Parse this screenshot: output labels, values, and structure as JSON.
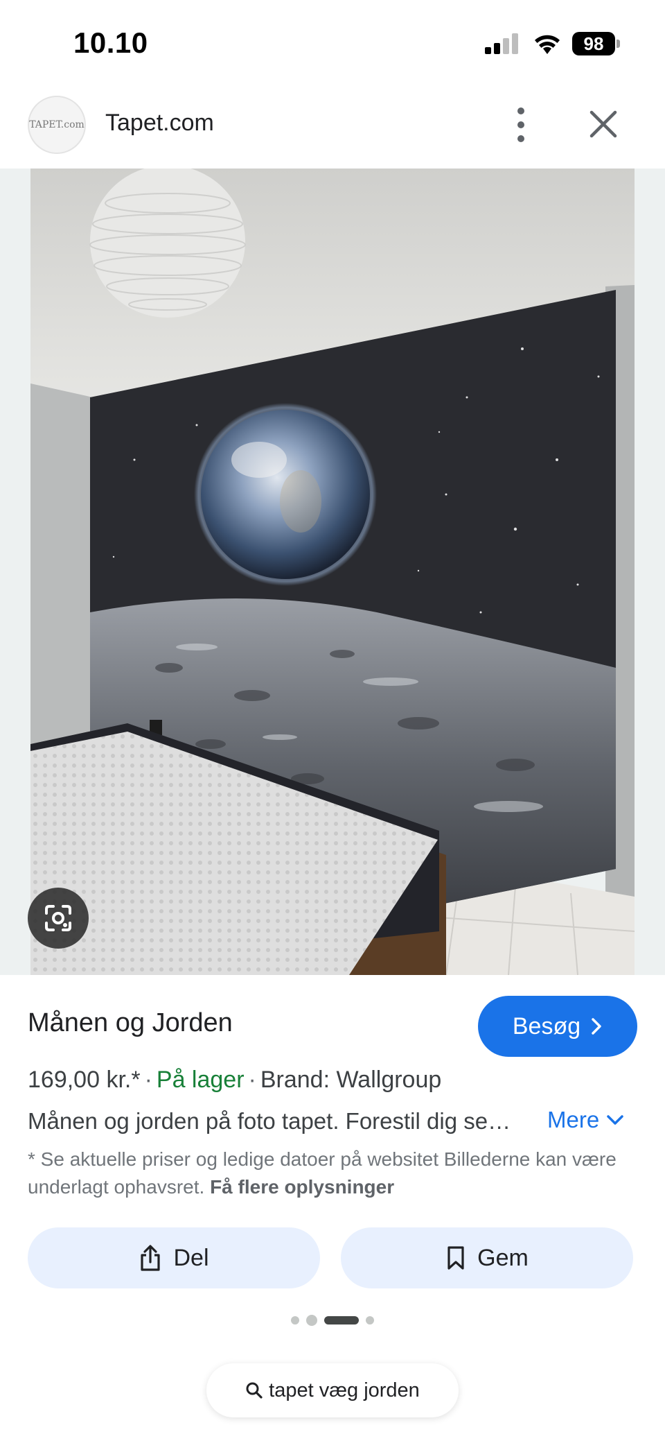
{
  "status_bar": {
    "time": "10.10",
    "battery": "98"
  },
  "header": {
    "site_name": "Tapet.com",
    "logo_text": "TAPET.com"
  },
  "product": {
    "title": "Månen og Jorden",
    "visit_label": "Besøg",
    "price": "169,00 kr.*",
    "stock": "På lager",
    "brand": "Brand: Wallgroup",
    "description": "Månen og jorden på foto tapet. Forestil dig se…",
    "more_label": "Mere",
    "note": "* Se aktuelle priser og ledige datoer på websitet Billederne kan være underlagt ophavsret.",
    "note_link": "Få flere oplysninger"
  },
  "actions": {
    "share_label": "Del",
    "save_label": "Gem"
  },
  "pager": {
    "count": 4,
    "active_index": 2
  },
  "search_chip": {
    "query": "tapet væg jorden"
  },
  "colors": {
    "accent": "#1a73e8",
    "stock_green": "#188038",
    "chip_bg": "#e8f0fe"
  },
  "icons": [
    "signal-icon",
    "wifi-icon",
    "more-vert-icon",
    "close-icon",
    "google-lens-icon",
    "chevron-right-icon",
    "chevron-down-icon",
    "share-icon",
    "bookmark-icon",
    "search-icon"
  ]
}
